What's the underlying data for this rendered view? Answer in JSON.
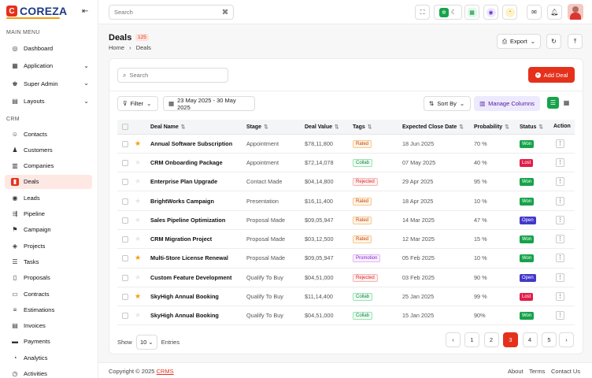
{
  "brand": {
    "name": "COREZA",
    "mark": "C"
  },
  "sidebar": {
    "main_menu_title": "MAIN MENU",
    "crm_title": "CRM",
    "main_items": [
      {
        "label": "Dashboard",
        "icon": "dashboard-icon",
        "glyph": "◎",
        "has_chevron": false
      },
      {
        "label": "Application",
        "icon": "application-icon",
        "glyph": "▦",
        "has_chevron": true
      },
      {
        "label": "Super Admin",
        "icon": "super-admin-icon",
        "glyph": "♚",
        "has_chevron": true
      },
      {
        "label": "Layouts",
        "icon": "layouts-icon",
        "glyph": "▤",
        "has_chevron": true
      }
    ],
    "crm_items": [
      {
        "label": "Contacts",
        "icon": "contacts-icon",
        "glyph": "☺",
        "active": false
      },
      {
        "label": "Customers",
        "icon": "customers-icon",
        "glyph": "♟",
        "active": false
      },
      {
        "label": "Companies",
        "icon": "companies-icon",
        "glyph": "▥",
        "active": false
      },
      {
        "label": "Deals",
        "icon": "deals-icon",
        "glyph": "▮",
        "active": true
      },
      {
        "label": "Leads",
        "icon": "leads-icon",
        "glyph": "◉",
        "active": false
      },
      {
        "label": "Pipeline",
        "icon": "pipeline-icon",
        "glyph": "⇶",
        "active": false
      },
      {
        "label": "Campaign",
        "icon": "campaign-icon",
        "glyph": "⚑",
        "active": false
      },
      {
        "label": "Projects",
        "icon": "projects-icon",
        "glyph": "◈",
        "active": false
      },
      {
        "label": "Tasks",
        "icon": "tasks-icon",
        "glyph": "☰",
        "active": false
      },
      {
        "label": "Proposals",
        "icon": "proposals-icon",
        "glyph": "▯",
        "active": false
      },
      {
        "label": "Contracts",
        "icon": "contracts-icon",
        "glyph": "▭",
        "active": false
      },
      {
        "label": "Estimations",
        "icon": "estimations-icon",
        "glyph": "≡",
        "active": false
      },
      {
        "label": "Invoices",
        "icon": "invoices-icon",
        "glyph": "▤",
        "active": false
      },
      {
        "label": "Payments",
        "icon": "payments-icon",
        "glyph": "▬",
        "active": false
      },
      {
        "label": "Analytics",
        "icon": "analytics-icon",
        "glyph": "◔",
        "active": false
      },
      {
        "label": "Activities",
        "icon": "activities-icon",
        "glyph": "◷",
        "active": false
      }
    ]
  },
  "topbar": {
    "search_placeholder": "Search",
    "shortcut_icon": "⌘"
  },
  "page": {
    "title": "Deals",
    "count": "125",
    "breadcrumb": {
      "home": "Home",
      "sep": "›",
      "current": "Deals"
    },
    "export_label": "Export"
  },
  "toolbar": {
    "search_placeholder": "Search",
    "add_label": "Add Deal",
    "filter_label": "Filter",
    "date_range": "23 May 2025 - 30 May 2025",
    "sort_label": "Sort By",
    "manage_label": "Manage Columns"
  },
  "table": {
    "headers": {
      "name": "Deal Name",
      "stage": "Stage",
      "value": "Deal Value",
      "tags": "Tags",
      "close": "Expected Close Date",
      "prob": "Probability",
      "status": "Status",
      "action": "Action"
    },
    "rows": [
      {
        "starred": true,
        "name": "Annual Software Subscription",
        "stage": "Appointment",
        "value": "$78,11,800",
        "tag": "Rated",
        "close": "18 Jun 2025",
        "prob": "70 %",
        "status": "Won"
      },
      {
        "starred": false,
        "name": " CRM Onboarding Package",
        "stage": "Appointment",
        "value": "$72,14,078",
        "tag": "Collab",
        "close": "07 May 2025",
        "prob": "40 %",
        "status": "Lost"
      },
      {
        "starred": false,
        "name": "Enterprise Plan Upgrade",
        "stage": "Contact Made",
        "value": "$04,14,800",
        "tag": "Rejected",
        "close": "29 Apr 2025",
        "prob": "95 %",
        "status": "Won"
      },
      {
        "starred": false,
        "name": "BrightWorks Campaign",
        "stage": "Presentation",
        "value": "$16,11,400",
        "tag": "Rated",
        "close": "18 Apr 2025",
        "prob": "10 %",
        "status": "Won"
      },
      {
        "starred": false,
        "name": "Sales Pipeline Optimization",
        "stage": "Proposal Made",
        "value": "$09,05,947",
        "tag": "Rated",
        "close": "14 Mar 2025",
        "prob": "47 %",
        "status": "Open"
      },
      {
        "starred": false,
        "name": "CRM Migration Project",
        "stage": "Proposal Made",
        "value": "$03,12,500",
        "tag": "Rated",
        "close": "12 Mar 2025",
        "prob": "15 %",
        "status": "Won"
      },
      {
        "starred": true,
        "name": "Multi-Store License Renewal",
        "stage": "Proposal Made",
        "value": "$09,05,947",
        "tag": "Promotion",
        "close": "05 Feb 2025",
        "prob": "10 %",
        "status": "Won"
      },
      {
        "starred": false,
        "name": " Custom Feature Development",
        "stage": "Qualify To Buy",
        "value": "$04,51,000",
        "tag": "Rejected",
        "close": "03 Feb 2025",
        "prob": "90 %",
        "status": "Open"
      },
      {
        "starred": true,
        "name": "SkyHigh Annual Booking",
        "stage": "Qualify To Buy",
        "value": "$11,14,400",
        "tag": "Collab",
        "close": "25 Jan 2025",
        "prob": "99 %",
        "status": "Lost"
      },
      {
        "starred": false,
        "name": "SkyHigh Annual Booking",
        "stage": "Qualify To Buy",
        "value": "$04,51,000",
        "tag": "Collab",
        "close": "15 Jan 2025",
        "prob": "90%",
        "status": "Won"
      }
    ]
  },
  "pagination": {
    "show_label": "Show",
    "entries_value": "10",
    "entries_label": "Entries",
    "pages": [
      "1",
      "2",
      "3",
      "4",
      "5"
    ],
    "active_page": "3",
    "prev": "‹",
    "next": "›"
  },
  "footer": {
    "copyright": "Copyright © 2025 ",
    "brand": "CRMS",
    "links": [
      "About",
      "Terms",
      "Contact Us"
    ]
  },
  "colors": {
    "accent": "#e5311c",
    "won": "#16a34a",
    "lost": "#e11d48",
    "open": "#4338ca"
  }
}
